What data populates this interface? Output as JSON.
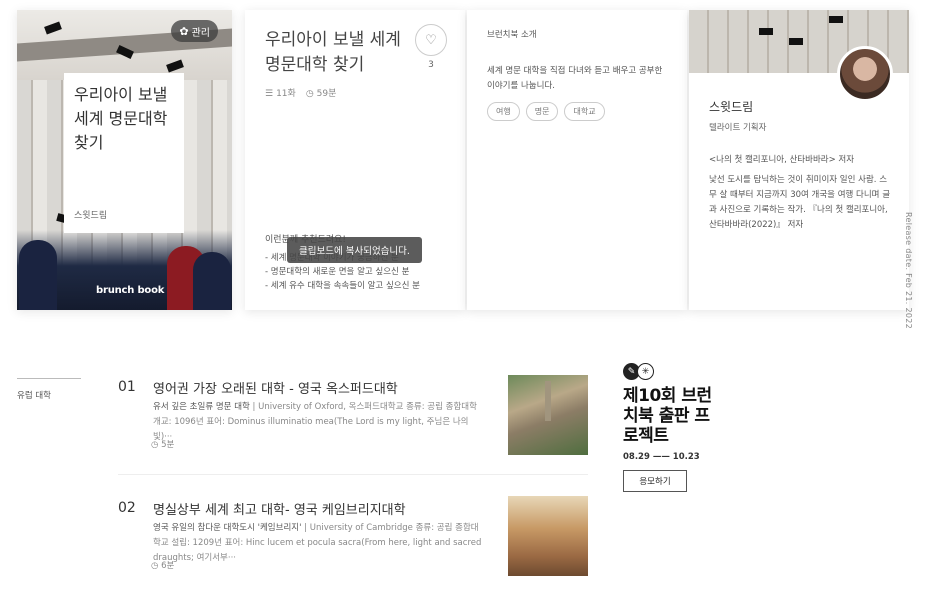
{
  "book": {
    "cover": {
      "admin_label": "관리",
      "title": "우리아이 보낼 세계 명문대학 찾기",
      "author": "스윗드림",
      "publisher_logo": "brunch book"
    },
    "info": {
      "title": "우리아이 보낼 세계 명문대학 찾기",
      "like_count": "3",
      "episodes": "11화",
      "read_time": "59분",
      "recommend_title": "이런분께 추천드려요!",
      "recommend_items": [
        "- 세계 명문대학 이야기가 궁금하신 분",
        "- 명문대학의 새로운 면을 알고 싶으신 분",
        "- 세계 유수 대학을 속속들이 알고 싶으신 분"
      ],
      "toast": "클립보드에 복사되었습니다."
    },
    "intro": {
      "heading": "브런치북 소개",
      "description": "세계 명문 대학을 직접 다녀와 듣고 배우고 공부한 이야기를 나눕니다.",
      "tags": [
        "여행",
        "명문",
        "대학교"
      ]
    },
    "author": {
      "name": "스윗드림",
      "role": "텔라이트 기획자",
      "works": "<나의 첫 캘리포니아, 산타바바라> 저자",
      "bio": "낯선 도시를 탐닉하는 것이 취미이자 일인 사람. 스무 살 때부터 지금까지 30여 개국을 여행 다니며 글과 사진으로 기록하는 작가. 『나의 첫 캘리포니아, 산타바바라(2022)』 저자"
    },
    "release": "Release date. Feb 21. 2022"
  },
  "magazine": {
    "label": "유럽 대학",
    "articles": [
      {
        "num": "01",
        "title": "영어권 가장 오래된 대학 - 영국 옥스퍼드대학",
        "desc_lead": "유서 깊은 초일류 명문 대학",
        "desc_rest": "University of Oxford, 옥스퍼드대학교 종류: 공립 종합대학 개교: 1096년 표어: Dominus illuminatio mea(The Lord is my light, 주님은 나의 빛)···",
        "time": "5분"
      },
      {
        "num": "02",
        "title": "명실상부 세계 최고 대학- 영국 케임브리지대학",
        "desc_lead": "영국 유일의 참다운 대학도시 '케임브리지'",
        "desc_rest": "University of Cambridge 종류: 공립 종합대학교 설립: 1209년 표어: Hinc lucem et pocula sacra(From here, light and sacred draughts; 여기서부···",
        "time": "6분"
      }
    ]
  },
  "promo": {
    "title": "제10회 브런치북 출판 프로젝트",
    "date": "08.29 —— 10.23",
    "button": "응모하기"
  },
  "colors": {
    "toast_bg": "#464646",
    "title_text": "#444444",
    "promo_text": "#111111"
  }
}
